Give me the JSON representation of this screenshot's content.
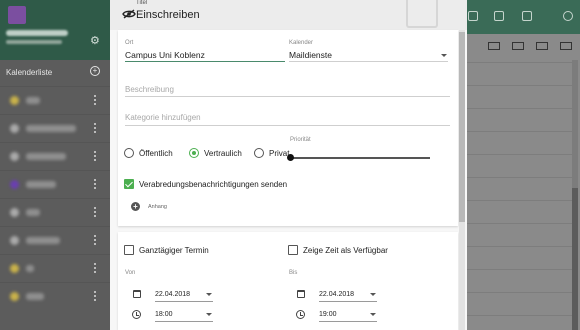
{
  "app": {
    "sidebar": {
      "calendar_list_label": "Kalenderliste"
    }
  },
  "dialog": {
    "subtitle": "Titel",
    "title": "Einschreiben",
    "location_label": "Ort",
    "location_value": "Campus Uni Koblenz",
    "calendar_label": "Kalender",
    "calendar_value": "Maildienste",
    "description_placeholder": "Beschreibung",
    "category_placeholder": "Kategorie hinzufügen",
    "visibility_options": [
      "Öffentlich",
      "Vertraulich",
      "Privat"
    ],
    "visibility_selected": "Vertraulich",
    "priority_label": "Priorität",
    "priority_value": 0,
    "notify_label": "Verabredungsbenachrichtigungen senden",
    "notify_checked": true,
    "attachment_label": "Anhang",
    "all_day_label": "Ganztägiger Termin",
    "all_day_checked": false,
    "show_available_label": "Zeige Zeit als Verfügbar",
    "show_available_checked": false,
    "from_label": "Von",
    "to_label": "Bis",
    "from_date": "22.04.2018",
    "from_time": "18:00",
    "to_date": "22.04.2018",
    "to_time": "19:00"
  },
  "colors": {
    "accent": "#4caf50",
    "header_green": "#3a6b57"
  }
}
